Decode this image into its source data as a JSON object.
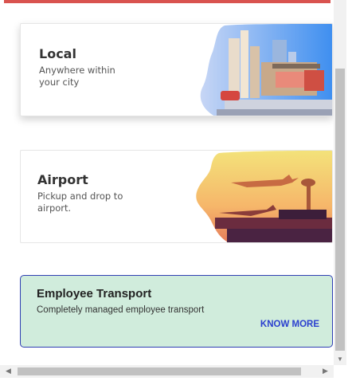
{
  "cards": [
    {
      "title": "Local",
      "subtitle": "Anywhere within your city"
    },
    {
      "title": "Airport",
      "subtitle": "Pickup and drop to airport."
    }
  ],
  "employee": {
    "title": "Employee Transport",
    "subtitle": "Completely managed employee transport",
    "link": "KNOW MORE"
  },
  "colors": {
    "top_bar": "#d9534f",
    "employee_bg": "#d0ecdc",
    "employee_border": "#2f3eb3",
    "link": "#2a3fcf"
  },
  "icons": {
    "scroll_left": "◀",
    "scroll_right": "▶",
    "scroll_down": "▼"
  }
}
